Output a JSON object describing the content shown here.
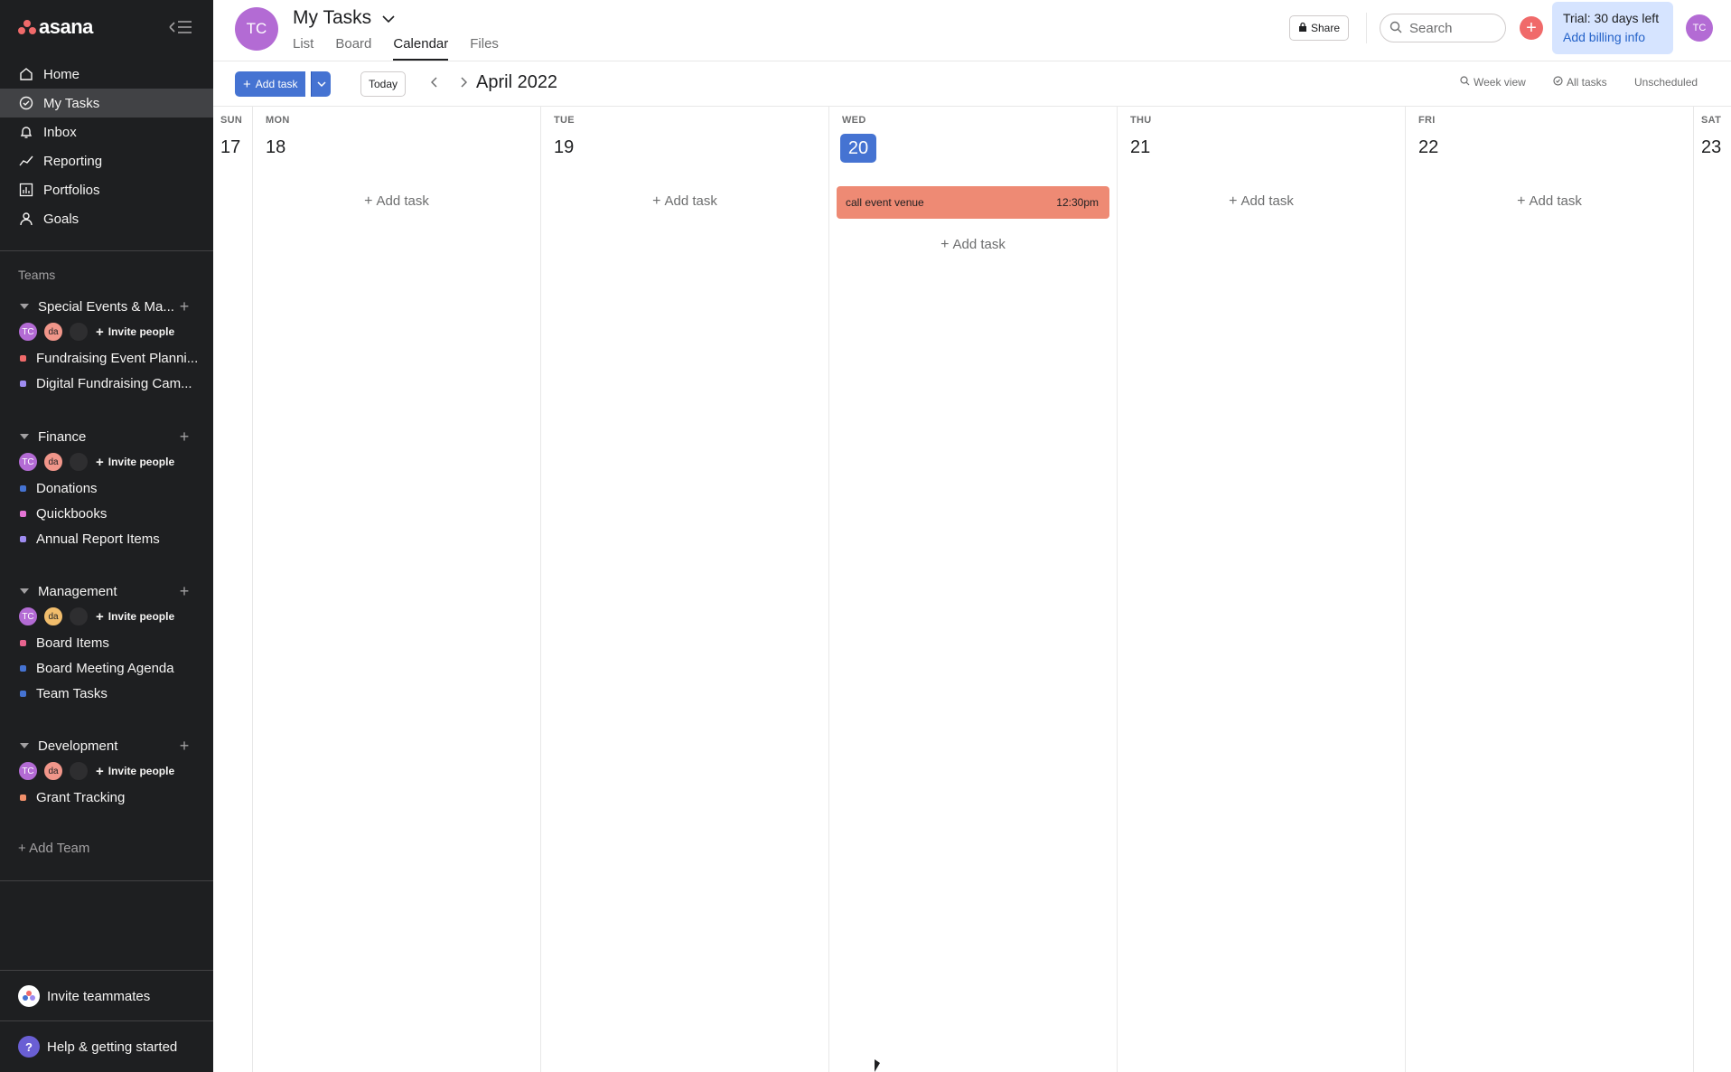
{
  "sidebar": {
    "logo": "asana",
    "nav": [
      {
        "label": "Home",
        "icon": "home-icon"
      },
      {
        "label": "My Tasks",
        "icon": "check-circle-icon",
        "active": true
      },
      {
        "label": "Inbox",
        "icon": "bell-icon"
      },
      {
        "label": "Reporting",
        "icon": "chart-line-icon"
      },
      {
        "label": "Portfolios",
        "icon": "bar-chart-icon"
      },
      {
        "label": "Goals",
        "icon": "person-icon"
      }
    ],
    "teams_label": "Teams",
    "teams": [
      {
        "name": "Special Events & Ma...",
        "invite": "Invite people",
        "da_color": "#f1968a",
        "projects": [
          {
            "name": "Fundraising Event Planni...",
            "color": "#f06a6a"
          },
          {
            "name": "Digital Fundraising Cam...",
            "color": "#9e8bf0"
          }
        ]
      },
      {
        "name": "Finance",
        "invite": "Invite people",
        "da_color": "#f1968a",
        "projects": [
          {
            "name": "Donations",
            "color": "#4573d2"
          },
          {
            "name": "Quickbooks",
            "color": "#e474d5"
          },
          {
            "name": "Annual Report Items",
            "color": "#9e8bf0"
          }
        ]
      },
      {
        "name": "Management",
        "invite": "Invite people",
        "da_color": "#f1bd6c",
        "projects": [
          {
            "name": "Board Items",
            "color": "#e8648f"
          },
          {
            "name": "Board Meeting Agenda",
            "color": "#4573d2"
          },
          {
            "name": "Team Tasks",
            "color": "#4573d2"
          }
        ]
      },
      {
        "name": "Development",
        "invite": "Invite people",
        "da_color": "#f1968a",
        "projects": [
          {
            "name": "Grant Tracking",
            "color": "#f1906b"
          }
        ]
      }
    ],
    "avatar_tc": "TC",
    "avatar_da": "da",
    "add_team": "Add Team",
    "invite_teammates": "Invite teammates",
    "help": "Help & getting started"
  },
  "header": {
    "avatar": "TC",
    "title": "My Tasks",
    "tabs": [
      "List",
      "Board",
      "Calendar",
      "Files"
    ],
    "active_tab": "Calendar",
    "share": "Share",
    "search_placeholder": "Search",
    "trial_line1": "Trial: 30 days left",
    "trial_line2": "Add billing info",
    "user_avatar": "TC"
  },
  "toolbar": {
    "add_task": "Add task",
    "today": "Today",
    "month": "April 2022",
    "week_view": "Week view",
    "all_tasks": "All tasks",
    "unscheduled": "Unscheduled"
  },
  "calendar": {
    "add_task_label": "Add task",
    "days": [
      {
        "dow": "SUN",
        "num": "17"
      },
      {
        "dow": "MON",
        "num": "18"
      },
      {
        "dow": "TUE",
        "num": "19"
      },
      {
        "dow": "WED",
        "num": "20",
        "today": true
      },
      {
        "dow": "THU",
        "num": "21"
      },
      {
        "dow": "FRI",
        "num": "22"
      },
      {
        "dow": "SAT",
        "num": "23"
      }
    ],
    "event": {
      "title": "call event venue",
      "time": "12:30pm"
    }
  },
  "colors": {
    "sidebar_bg": "#1e1f21",
    "accent_blue": "#4573d2",
    "event_coral": "#ee8a74",
    "brand_red": "#f06a6a"
  }
}
